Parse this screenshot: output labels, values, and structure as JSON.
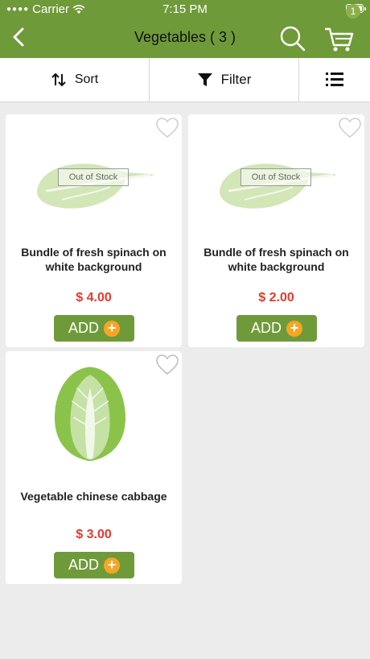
{
  "status": {
    "carrier": "Carrier",
    "time": "7:15 PM"
  },
  "header": {
    "title": "Vegetables ( 3 )",
    "cart_count": "1"
  },
  "toolbar": {
    "sort_label": "Sort",
    "filter_label": "Filter"
  },
  "colors": {
    "brand_green": "#6f9a3a",
    "price_red": "#e53a2e",
    "add_plus": "#f6a623"
  },
  "products": [
    {
      "name": "Bundle of fresh spinach on white background",
      "price": "$ 4.00",
      "add_label": "ADD",
      "badge": "Out of Stock",
      "image": "spinach-image"
    },
    {
      "name": "Bundle of fresh spinach on white background",
      "price": "$ 2.00",
      "add_label": "ADD",
      "badge": "Out of Stock",
      "image": "spinach-image"
    },
    {
      "name": "Vegetable chinese cabbage",
      "price": "$ 3.00",
      "add_label": "ADD",
      "image": "cabbage-image"
    }
  ]
}
